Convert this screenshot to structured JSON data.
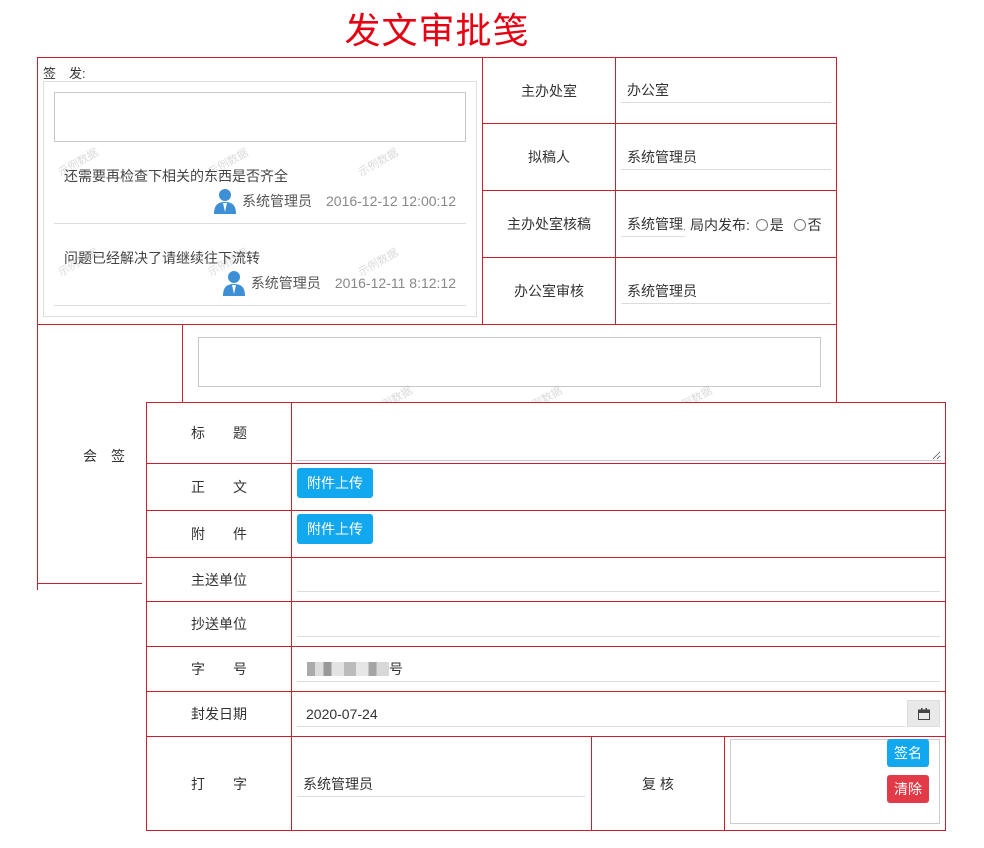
{
  "title": "发文审批笺",
  "top_left": {
    "sign_label": "签　发:",
    "comments": [
      {
        "text": "还需要再检查下相关的东西是否齐全",
        "user": "系统管理员",
        "date": "2016-12-12 12:00:12"
      },
      {
        "text": "问题已经解决了请继续往下流转",
        "user": "系统管理员",
        "date": "2016-12-11 8:12:12"
      }
    ],
    "watermark": "示例数据"
  },
  "right_rows": [
    {
      "label": "主办处室",
      "value": "办公室"
    },
    {
      "label": "拟稿人",
      "value": "系统管理员"
    },
    {
      "label": "主办处室核稿",
      "value": "系统管理员",
      "publish_label": "局内发布:",
      "yes": "是",
      "no": "否"
    },
    {
      "label": "办公室审核",
      "value": "系统管理员"
    }
  ],
  "countersign_label": "会　签",
  "form": {
    "title_label": "标　　题",
    "body_label": "正　　文",
    "attachment_label": "附　　件",
    "upload_label": "附件上传",
    "main_unit_label": "主送单位",
    "cc_unit_label": "抄送单位",
    "doc_no_label": "字　　号",
    "doc_no_suffix": "号",
    "seal_date_label": "封发日期",
    "seal_date_value": "2020-07-24",
    "typist_label": "打　　字",
    "typist_value": "系统管理员",
    "review_label": "复 核",
    "sign_button": "签名",
    "clear_button": "清除"
  },
  "colors": {
    "border": "#cc1f2d",
    "title": "#e60012",
    "primary": "#12a8f0",
    "danger": "#e23b47",
    "avatar": "#3d8fd6"
  }
}
